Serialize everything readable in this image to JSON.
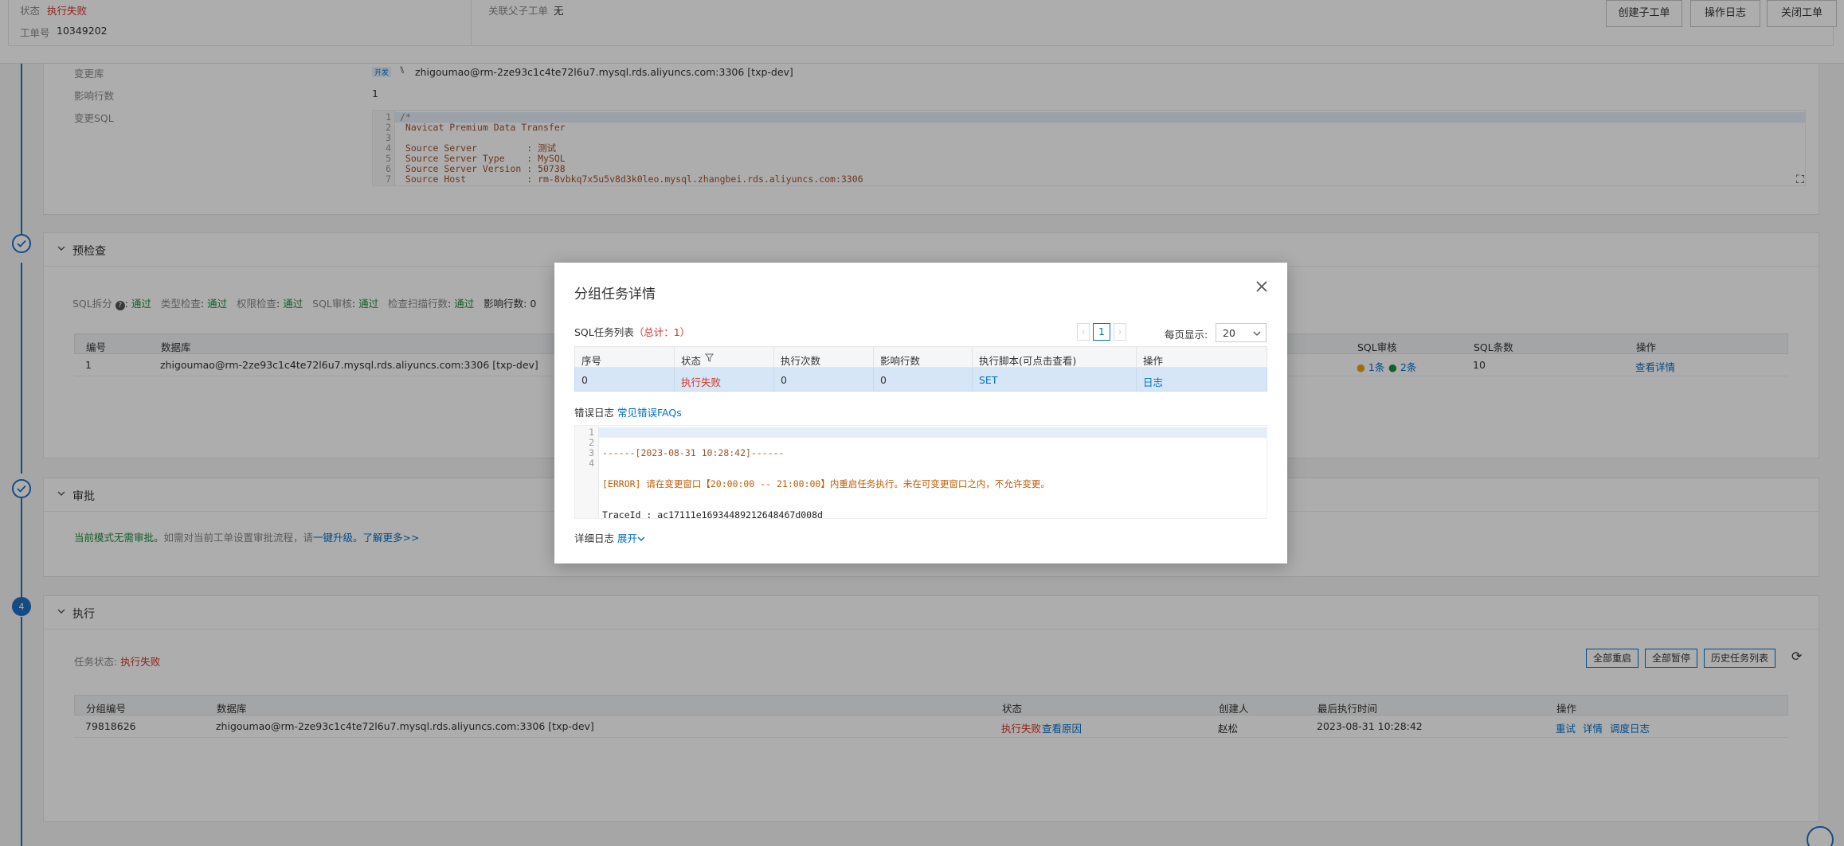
{
  "header": {
    "status_label": "状态",
    "status_value": "执行失败",
    "order_label": "工单号",
    "order_value": "10349202",
    "parent_label": "关联父子工单",
    "parent_value": "无",
    "buttons": [
      "创建子工单",
      "操作日志",
      "关闭工单"
    ]
  },
  "change_section": {
    "db_label": "变更库",
    "env_tag": "开发",
    "db_value": "zhigoumao@rm-2ze93c1c4te72l6u7.mysql.rds.aliyuncs.com:3306 [txp-dev]",
    "rows_label": "影响行数",
    "rows_value": "1",
    "sql_label": "变更SQL",
    "sql_lines": [
      "/*",
      " Navicat Premium Data Transfer",
      "",
      " Source Server         : 测试",
      " Source Server Type    : MySQL",
      " Source Server Version : 50738",
      " Source Host           : rm-8vbkq7x5u5v8d3k0leo.mysql.zhangbei.rds.aliyuncs.com:3306"
    ],
    "sql_line_numbers": [
      "1",
      "2",
      "3",
      "4",
      "5",
      "6",
      "7"
    ]
  },
  "precheck": {
    "title": "预检查",
    "checks": [
      {
        "label": "SQL拆分",
        "value": "通过"
      },
      {
        "label": "类型检查",
        "value": "通过"
      },
      {
        "label": "权限检查",
        "value": "通过"
      },
      {
        "label": "SQL审核",
        "value": "通过"
      },
      {
        "label": "检查扫描行数",
        "value": "通过"
      }
    ],
    "affected_label": "影响行数: 0",
    "columns": [
      "编号",
      "数据库",
      "SQL审核",
      "SQL条数",
      "操作"
    ],
    "row": {
      "id": "1",
      "db": "zhigoumao@rm-2ze93c1c4te72l6u7.mysql.rds.aliyuncs.com:3306 [txp-dev]",
      "audit_a": "1条",
      "audit_b": "2条",
      "count": "10",
      "action": "查看详情"
    }
  },
  "approval": {
    "title": "审批",
    "text_green": "当前模式无需审批。",
    "text_mid": "如需对当前工单设置审批流程，请",
    "link1": "一键升级。",
    "link2": "了解更多>>"
  },
  "execution": {
    "step": "4",
    "title": "执行",
    "task_status_label": "任务状态:",
    "task_status_value": "执行失败",
    "buttons": [
      "全部重启",
      "全部暂停",
      "历史任务列表"
    ],
    "columns": [
      "分组编号",
      "数据库",
      "状态",
      "创建人",
      "最后执行时间",
      "操作"
    ],
    "row": {
      "group": "79818626",
      "db": "zhigoumao@rm-2ze93c1c4te72l6u7.mysql.rds.aliyuncs.com:3306 [txp-dev]",
      "status": "执行失败",
      "reason": "查看原因",
      "creator": "赵松",
      "time": "2023-08-31 10:28:42",
      "actions": [
        "重试",
        "详情",
        "调度日志"
      ]
    }
  },
  "modal": {
    "title": "分组任务详情",
    "list_label": "SQL任务列表",
    "total_text": "（总计：1）",
    "page": "1",
    "page_size_label": "每页显示:",
    "page_size": "20",
    "columns": [
      "序号",
      "状态",
      "执行次数",
      "影响行数",
      "执行脚本(可点击查看)",
      "操作"
    ],
    "row": {
      "seq": "0",
      "status": "执行失败",
      "exec_count": "0",
      "affected": "0",
      "script": "SET",
      "action": "日志"
    },
    "error_label": "错误日志",
    "faq_link": "常见错误FAQs",
    "error_lines": [
      "------[2023-08-31 10:28:42]------",
      "[ERROR] 请在变更窗口【20:00:00 -- 21:00:00】内重启任务执行。未在可变更窗口之内，不允许变更。",
      "TraceId : ac17111e16934489212648467d008d",
      ""
    ],
    "error_line_numbers": [
      "1",
      "2",
      "3",
      "4"
    ],
    "detail_label": "详细日志",
    "expand_link": "展开"
  },
  "colors": {
    "primary": "#0070cc",
    "danger": "#d93026",
    "success": "#1e8e3e",
    "timeline": "#1f6fc5"
  }
}
